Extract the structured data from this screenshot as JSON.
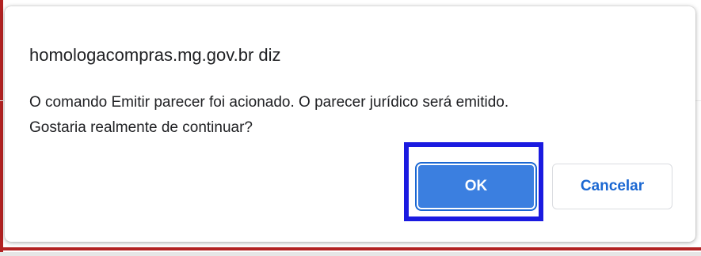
{
  "dialog": {
    "title": "homologacompras.mg.gov.br diz",
    "message_line1": "O comando Emitir parecer foi acionado. O parecer jurídico será emitido.",
    "message_line2": "Gostaria realmente de continuar?",
    "ok_label": "OK",
    "cancel_label": "Cancelar"
  },
  "colors": {
    "ok_button": "#3b7fe0",
    "cancel_text": "#1a67d2",
    "highlight_border": "#1a1ae0",
    "page_accent": "#b22222"
  }
}
